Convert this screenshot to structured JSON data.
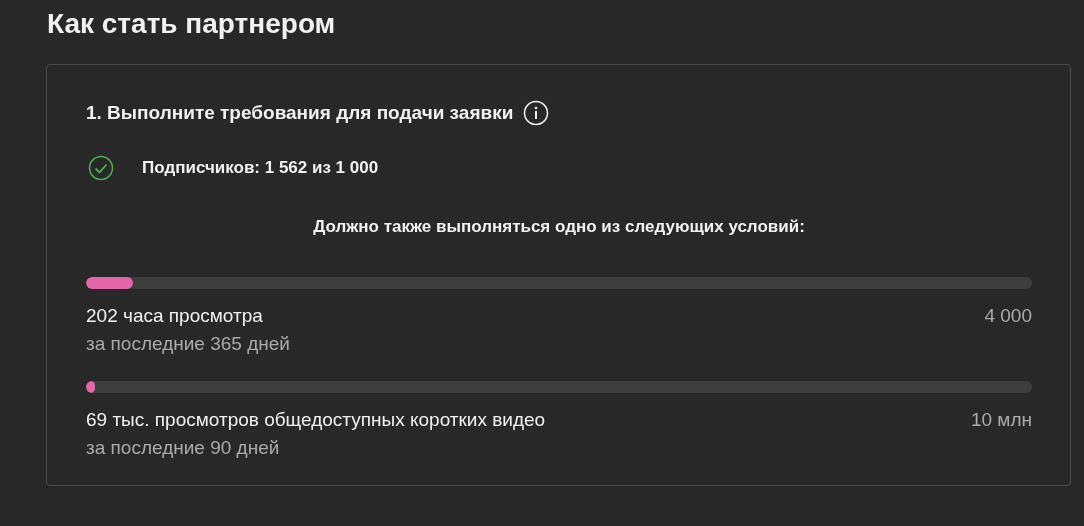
{
  "title": "Как стать партнером",
  "card": {
    "heading": "1. Выполните требования для подачи заявки",
    "requirement": {
      "text": "Подписчиков: 1 562 из 1 000",
      "met": true
    },
    "condition_note": "Должно также выполняться одно из следующих условий:",
    "metrics": [
      {
        "label": "202 часа просмотра",
        "target": "4 000",
        "period": "за последние 365 дней",
        "level": 0.05
      },
      {
        "label": "69 тыс. просмотров общедоступных коротких видео",
        "target": "10 млн",
        "period": "за последние 90 дней",
        "level": 0.01
      }
    ]
  }
}
